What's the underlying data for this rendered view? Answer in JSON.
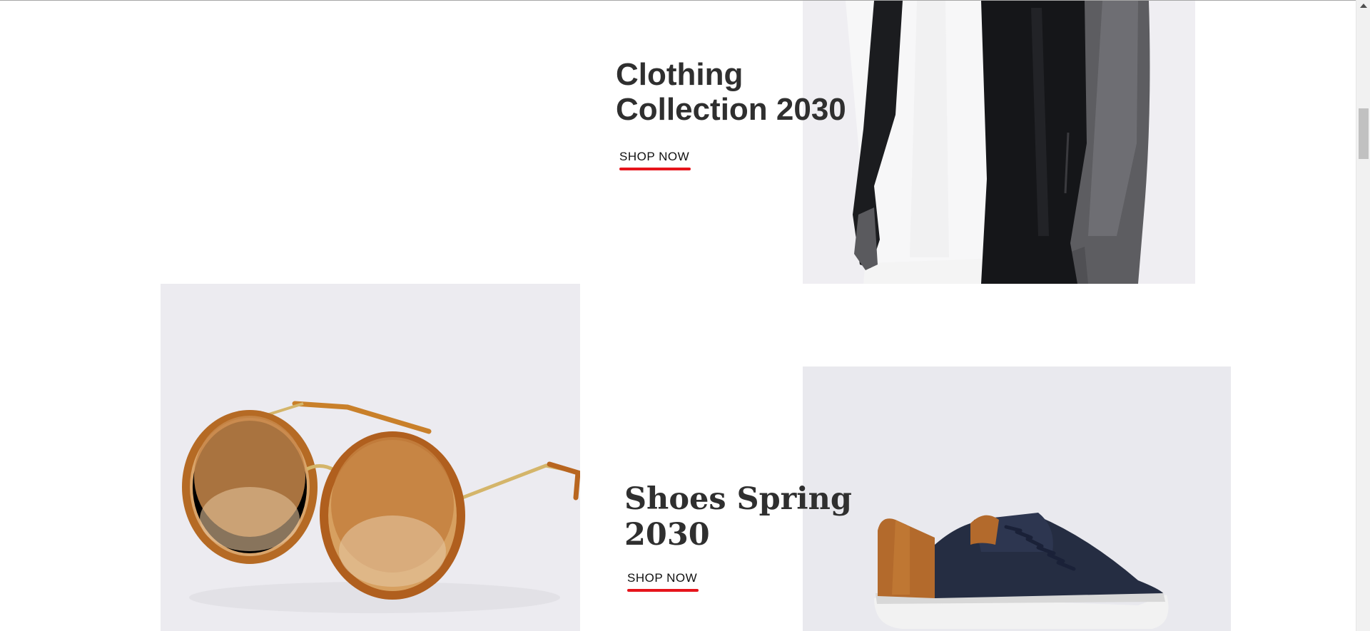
{
  "sections": {
    "clothing": {
      "title_line1": "Clothing",
      "title_line2": "Collection 2030",
      "cta_label": "SHOP NOW",
      "image_icon": "jacket-model-image"
    },
    "accessories": {
      "image_icon": "sunglasses-image"
    },
    "shoes": {
      "title_line1": "Shoes Spring",
      "title_line2": "2030",
      "cta_label": "SHOP NOW",
      "image_icon": "sneaker-image"
    }
  },
  "colors": {
    "accent_underline": "#e6141b",
    "heading_text": "#2f2f2f",
    "panel_background": "#efeff2"
  }
}
